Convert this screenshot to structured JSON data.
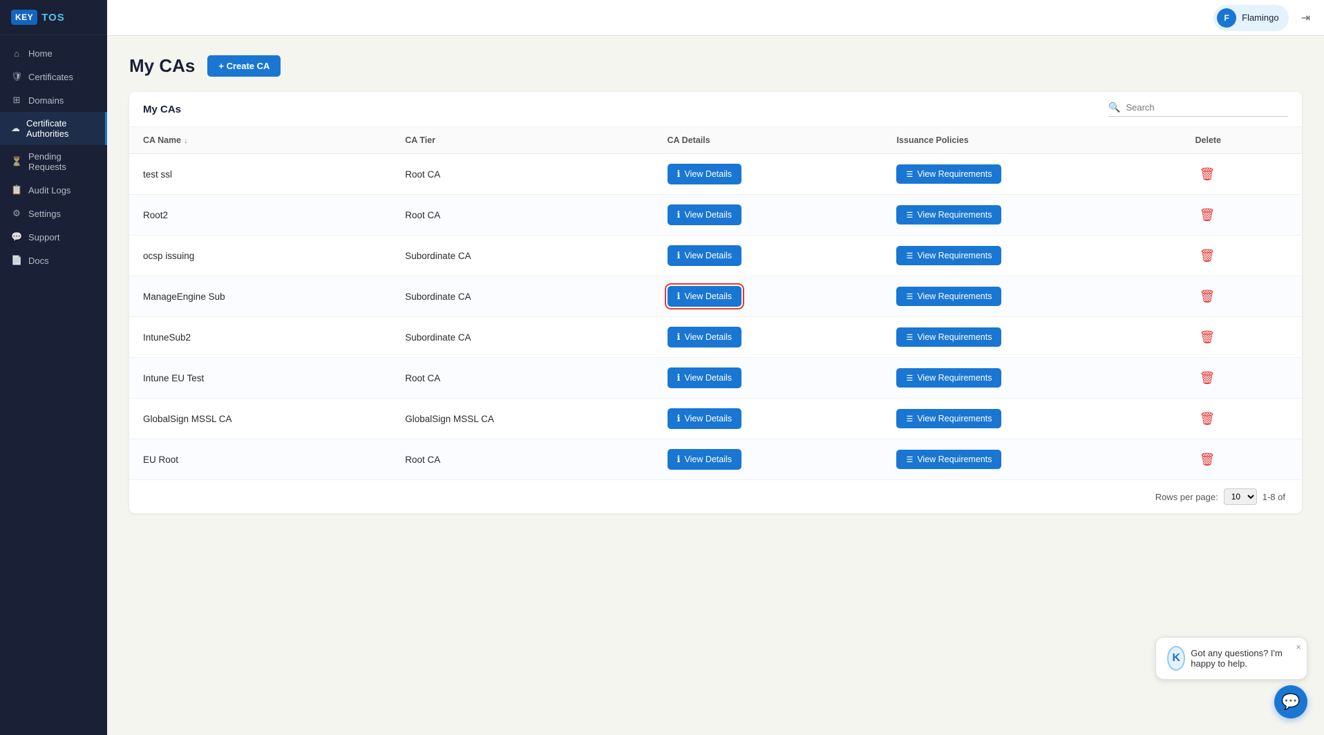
{
  "sidebar": {
    "logo_text": "TOS",
    "logo_key": "KEY",
    "nav_items": [
      {
        "id": "home",
        "label": "Home",
        "icon": "⌂"
      },
      {
        "id": "certificates",
        "label": "Certificates",
        "icon": "🛡"
      },
      {
        "id": "domains",
        "label": "Domains",
        "icon": "⊞"
      },
      {
        "id": "certificate-authorities",
        "label": "Certificate Authorities",
        "icon": "☁",
        "active": true
      },
      {
        "id": "pending-requests",
        "label": "Pending Requests",
        "icon": "⏳"
      },
      {
        "id": "audit-logs",
        "label": "Audit Logs",
        "icon": "📋"
      },
      {
        "id": "settings",
        "label": "Settings",
        "icon": "⚙"
      },
      {
        "id": "support",
        "label": "Support",
        "icon": "💬"
      },
      {
        "id": "docs",
        "label": "Docs",
        "icon": "📄"
      }
    ]
  },
  "header": {
    "user_initial": "F",
    "user_name": "Flamingo",
    "logout_icon": "⇥"
  },
  "page": {
    "title": "My CAs",
    "create_btn_label": "+ Create CA",
    "table_title": "My CAs",
    "search_placeholder": "Search",
    "columns": [
      {
        "key": "ca_name",
        "label": "CA Name",
        "sortable": true
      },
      {
        "key": "ca_tier",
        "label": "CA Tier"
      },
      {
        "key": "ca_details",
        "label": "CA Details"
      },
      {
        "key": "issuance_policies",
        "label": "Issuance Policies"
      },
      {
        "key": "delete",
        "label": "Delete"
      }
    ],
    "rows": [
      {
        "id": 1,
        "ca_name": "test ssl",
        "ca_tier": "Root CA",
        "highlighted": false
      },
      {
        "id": 2,
        "ca_name": "Root2",
        "ca_tier": "Root CA",
        "highlighted": false
      },
      {
        "id": 3,
        "ca_name": "ocsp issuing",
        "ca_tier": "Subordinate CA",
        "highlighted": false
      },
      {
        "id": 4,
        "ca_name": "ManageEngine Sub",
        "ca_tier": "Subordinate CA",
        "highlighted": true
      },
      {
        "id": 5,
        "ca_name": "IntuneSub2",
        "ca_tier": "Subordinate CA",
        "highlighted": false
      },
      {
        "id": 6,
        "ca_name": "Intune EU Test",
        "ca_tier": "Root CA",
        "highlighted": false
      },
      {
        "id": 7,
        "ca_name": "GlobalSign MSSL CA",
        "ca_tier": "GlobalSign MSSL CA",
        "highlighted": false
      },
      {
        "id": 8,
        "ca_name": "EU Root",
        "ca_tier": "Root CA",
        "highlighted": false
      }
    ],
    "btn_view_details": "View Details",
    "btn_view_requirements": "View Requirements",
    "pagination": {
      "rows_per_page_label": "Rows per page:",
      "rows_per_page_value": "10",
      "range": "1-8 of"
    }
  },
  "chat": {
    "message": "Got any questions? I'm happy to help.",
    "k_logo": "K",
    "close_icon": "×"
  }
}
